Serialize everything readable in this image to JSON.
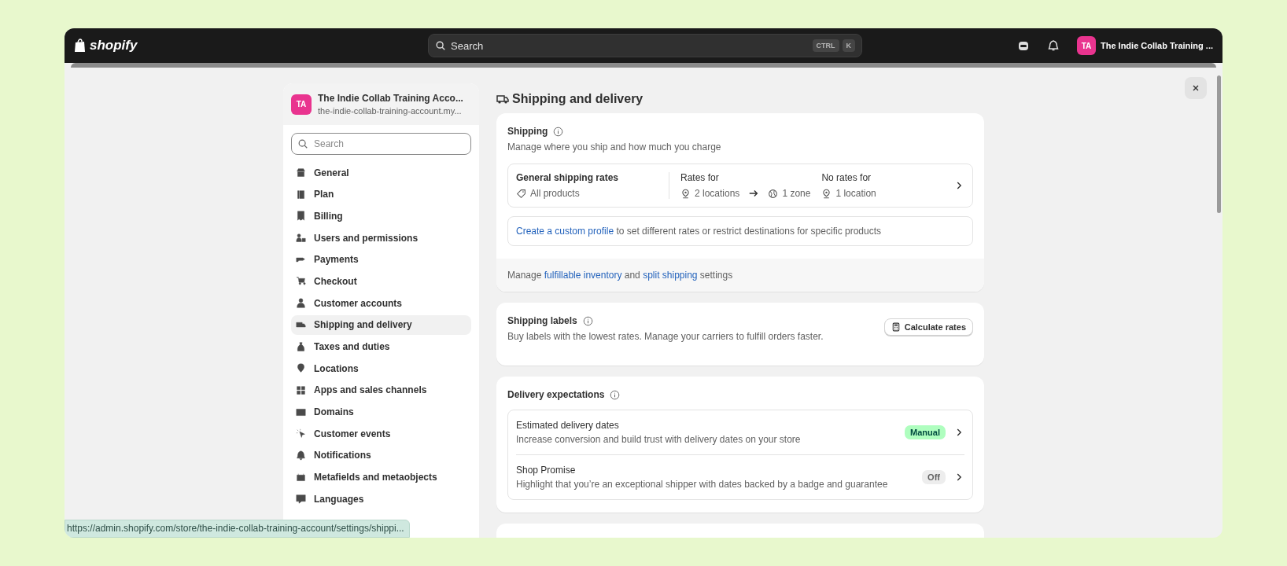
{
  "topbar": {
    "logo": "shopify",
    "search": {
      "placeholder": "Search",
      "keys": [
        "CTRL",
        "K"
      ]
    },
    "store": {
      "initials": "TA",
      "name": "The Indie Collab Training ..."
    }
  },
  "sidebar": {
    "store": {
      "initials": "TA",
      "name": "The Indie Collab Training Acco...",
      "domain": "the-indie-collab-training-account.my..."
    },
    "search": {
      "placeholder": "Search"
    },
    "items": [
      {
        "label": "General",
        "selected": false
      },
      {
        "label": "Plan",
        "selected": false
      },
      {
        "label": "Billing",
        "selected": false
      },
      {
        "label": "Users and permissions",
        "selected": false
      },
      {
        "label": "Payments",
        "selected": false
      },
      {
        "label": "Checkout",
        "selected": false
      },
      {
        "label": "Customer accounts",
        "selected": false
      },
      {
        "label": "Shipping and delivery",
        "selected": true
      },
      {
        "label": "Taxes and duties",
        "selected": false
      },
      {
        "label": "Locations",
        "selected": false
      },
      {
        "label": "Apps and sales channels",
        "selected": false
      },
      {
        "label": "Domains",
        "selected": false
      },
      {
        "label": "Customer events",
        "selected": false
      },
      {
        "label": "Notifications",
        "selected": false
      },
      {
        "label": "Metafields and metaobjects",
        "selected": false
      },
      {
        "label": "Languages",
        "selected": false
      }
    ]
  },
  "page": {
    "title": "Shipping and delivery"
  },
  "shipping": {
    "title": "Shipping",
    "subtitle": "Manage where you ship and how much you charge",
    "profile": {
      "name": "General shipping rates",
      "products": "All products",
      "rates_label": "Rates for",
      "locations": "2 locations",
      "zones": "1 zone",
      "no_rates_label": "No rates for",
      "no_rates": "1 location"
    },
    "custom_profile": {
      "link": "Create a custom profile",
      "text": " to set different rates or restrict destinations for specific products"
    },
    "footer": [
      {
        "text": "Manage ",
        "link": false
      },
      {
        "text": "fulfillable inventory",
        "link": true
      },
      {
        "text": " and ",
        "link": false
      },
      {
        "text": "split shipping",
        "link": true
      },
      {
        "text": " settings",
        "link": false
      }
    ]
  },
  "labels": {
    "title": "Shipping labels",
    "subtitle": "Buy labels with the lowest rates. Manage your carriers to fulfill orders faster.",
    "button": "Calculate rates"
  },
  "delivery": {
    "title": "Delivery expectations",
    "rows": [
      {
        "title": "Estimated delivery dates",
        "subtitle": "Increase conversion and build trust with delivery dates on your store",
        "badge": "Manual",
        "kind": "success"
      },
      {
        "title": "Shop Promise",
        "subtitle": "Highlight that you’re an exceptional shipper with dates backed by a badge and guarantee",
        "badge": "Off",
        "kind": "neutral"
      }
    ]
  },
  "status_url": "https://admin.shopify.com/store/the-indie-collab-training-account/settings/shippi..."
}
